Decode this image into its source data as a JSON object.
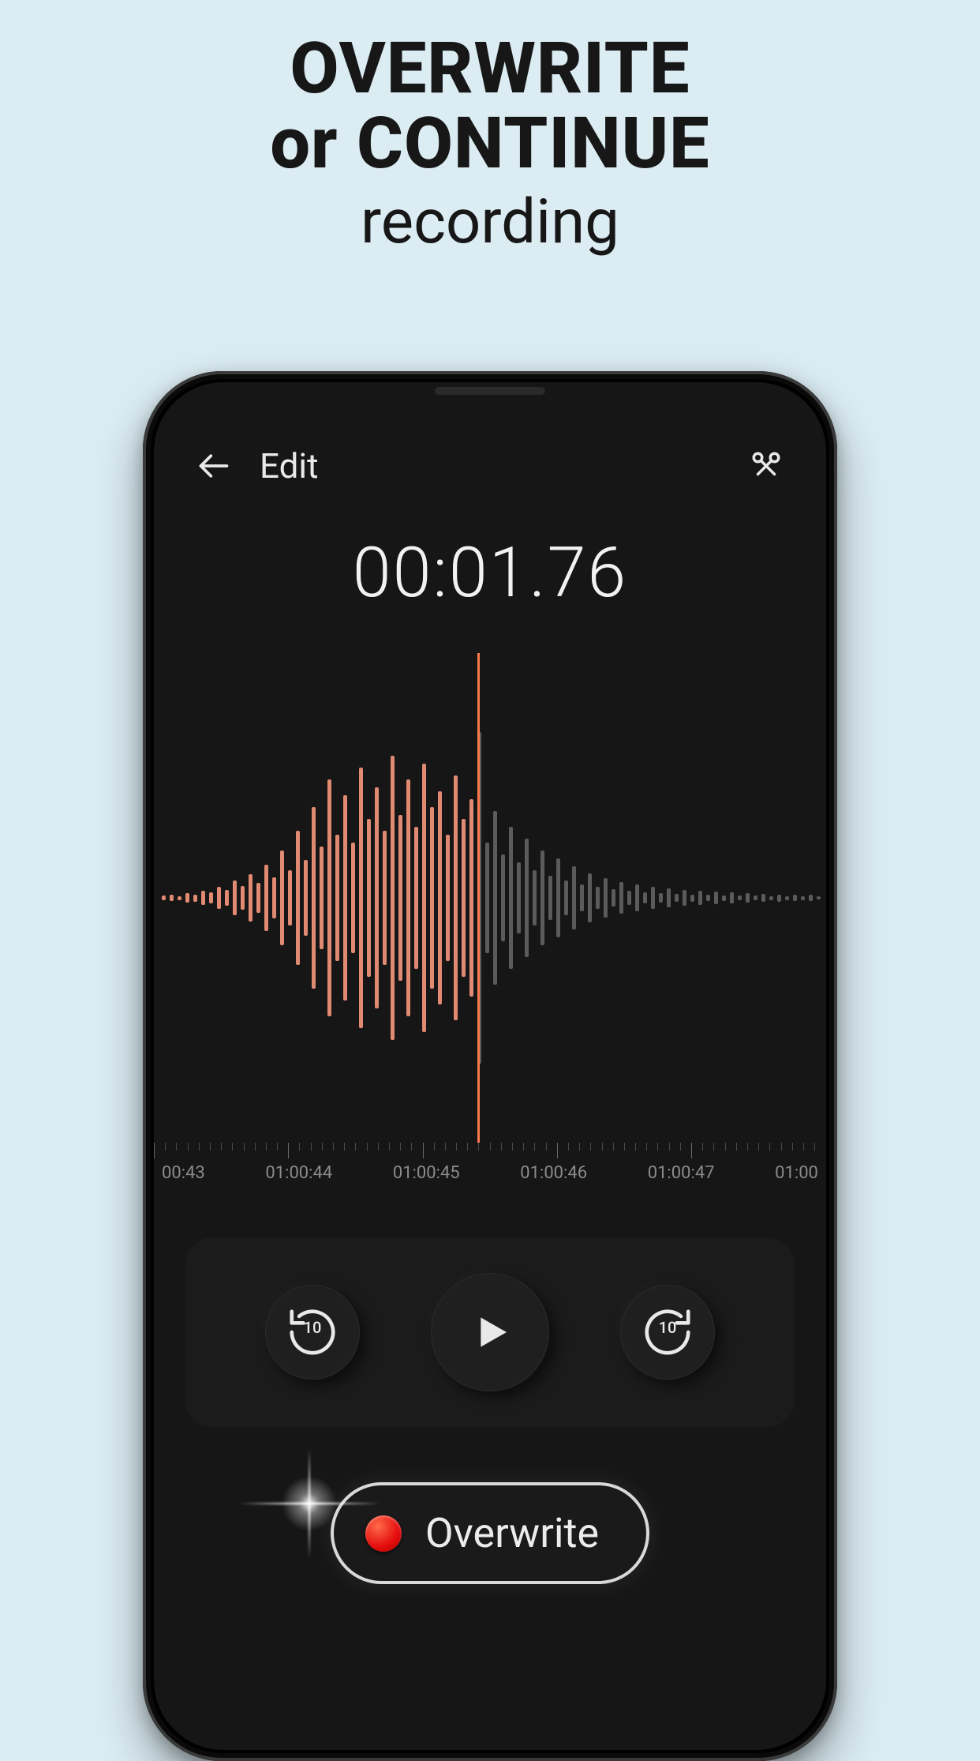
{
  "marketing": {
    "headline_bold_line1": "OVERWRITE",
    "headline_bold_line2": "or CONTINUE",
    "headline_light": "recording"
  },
  "appbar": {
    "title": "Edit"
  },
  "timer": {
    "display": "00:01.76"
  },
  "ruler": {
    "labels": [
      "00:43",
      "01:00:44",
      "01:00:45",
      "01:00:46",
      "01:00:47",
      "01:00"
    ]
  },
  "controls": {
    "rewind_seconds": "10",
    "forward_seconds": "10"
  },
  "overwrite": {
    "label": "Overwrite"
  },
  "colors": {
    "background": "#dbecf3",
    "screen": "#161616",
    "wave_past": "#e08a72",
    "wave_future": "#5b5b5b",
    "playhead": "#ff7a4d",
    "record_red": "#e40d0d"
  },
  "waveform": {
    "playhead_index": 40,
    "bars": [
      6,
      8,
      5,
      12,
      9,
      18,
      14,
      28,
      20,
      44,
      30,
      60,
      38,
      84,
      52,
      120,
      70,
      170,
      96,
      230,
      130,
      300,
      160,
      260,
      140,
      330,
      200,
      280,
      170,
      360,
      210,
      300,
      180,
      340,
      230,
      270,
      160,
      310,
      200,
      250,
      420,
      140,
      220,
      110,
      180,
      90,
      150,
      70,
      120,
      56,
      100,
      44,
      80,
      34,
      62,
      28,
      50,
      22,
      40,
      18,
      34,
      14,
      28,
      12,
      24,
      10,
      20,
      9,
      18,
      8,
      16,
      7,
      14,
      6,
      12,
      6,
      10,
      5,
      9,
      5,
      8,
      5,
      8,
      4
    ]
  }
}
